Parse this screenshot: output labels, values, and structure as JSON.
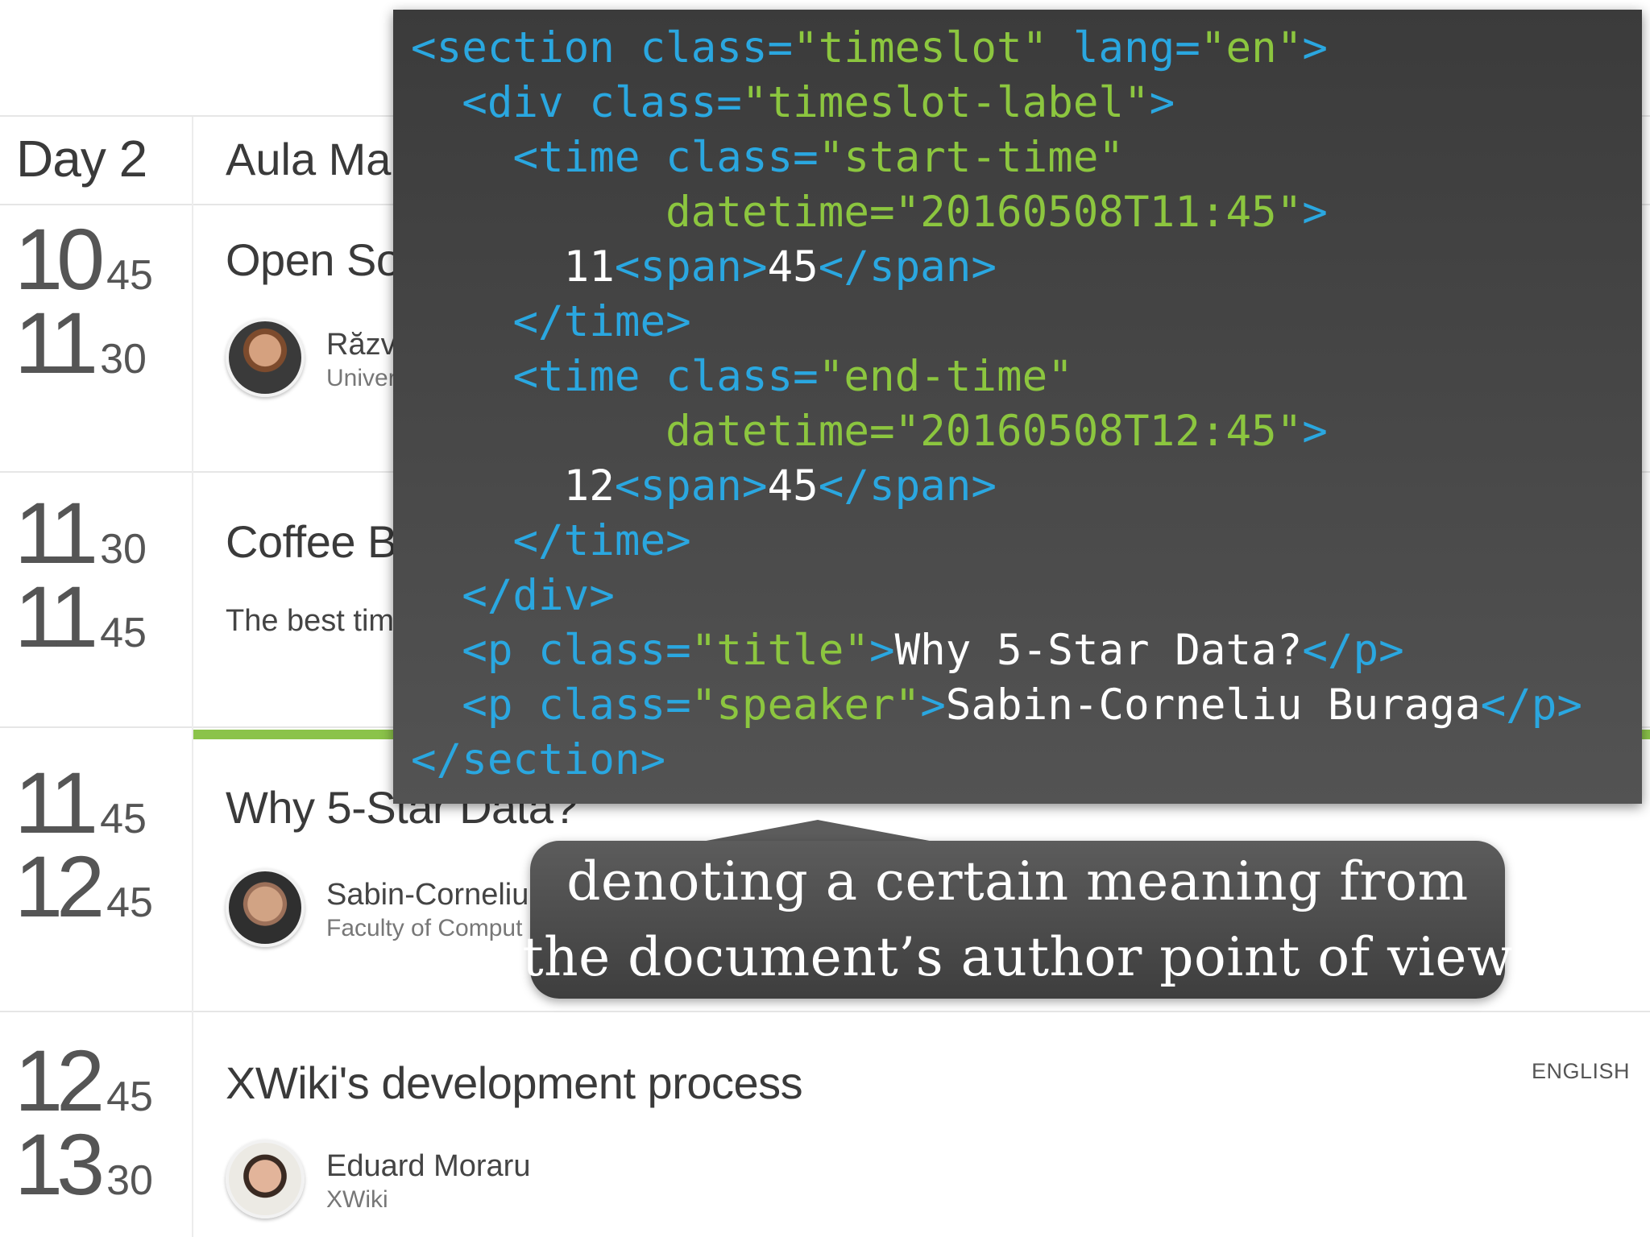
{
  "schedule": {
    "day": "Day 2",
    "room": "Aula Ma",
    "slots": [
      {
        "start": {
          "hour": "10",
          "min": "45"
        },
        "end": {
          "hour": "11",
          "min": "30"
        },
        "title": "Open So",
        "speaker": {
          "name": "Răzv",
          "affiliation": "Univer"
        }
      },
      {
        "start": {
          "hour": "11",
          "min": "30"
        },
        "end": {
          "hour": "11",
          "min": "45"
        },
        "title": "Coffee B",
        "description": "The best tim"
      },
      {
        "start": {
          "hour": "11",
          "min": "45"
        },
        "end": {
          "hour": "12",
          "min": "45"
        },
        "title": "Why 5-Star Data?",
        "speaker": {
          "name": "Sabin-Corneliu",
          "affiliation": "Faculty of Comput"
        }
      },
      {
        "start": {
          "hour": "12",
          "min": "45"
        },
        "end": {
          "hour": "13",
          "min": "30"
        },
        "title": "XWiki's development process",
        "language": "ENGLISH",
        "speaker": {
          "name": "Eduard Moraru",
          "affiliation": "XWiki"
        }
      }
    ]
  },
  "code_lines": [
    [
      {
        "t": "tag",
        "v": "<section "
      },
      {
        "t": "attr",
        "v": "class="
      },
      {
        "t": "str",
        "v": "\"timeslot\""
      },
      {
        "t": "attr",
        "v": " lang="
      },
      {
        "t": "str",
        "v": "\"en\""
      },
      {
        "t": "tag",
        "v": ">"
      }
    ],
    [
      {
        "t": "txt",
        "v": "  "
      },
      {
        "t": "tag",
        "v": "<div "
      },
      {
        "t": "attr",
        "v": "class="
      },
      {
        "t": "str",
        "v": "\"timeslot-label\""
      },
      {
        "t": "tag",
        "v": ">"
      }
    ],
    [
      {
        "t": "txt",
        "v": "    "
      },
      {
        "t": "tag",
        "v": "<time "
      },
      {
        "t": "attr",
        "v": "class="
      },
      {
        "t": "str",
        "v": "\"start-time\""
      }
    ],
    [
      {
        "t": "txt",
        "v": "          "
      },
      {
        "t": "str",
        "v": "datetime=\"20160508T11:45\""
      },
      {
        "t": "tag",
        "v": ">"
      }
    ],
    [
      {
        "t": "txt",
        "v": "      11"
      },
      {
        "t": "tag",
        "v": "<span>"
      },
      {
        "t": "txt",
        "v": "45"
      },
      {
        "t": "tag",
        "v": "</span>"
      }
    ],
    [
      {
        "t": "txt",
        "v": "    "
      },
      {
        "t": "tag",
        "v": "</time>"
      }
    ],
    [
      {
        "t": "txt",
        "v": "    "
      },
      {
        "t": "tag",
        "v": "<time "
      },
      {
        "t": "attr",
        "v": "class="
      },
      {
        "t": "str",
        "v": "\"end-time\""
      }
    ],
    [
      {
        "t": "txt",
        "v": "          "
      },
      {
        "t": "str",
        "v": "datetime=\"20160508T12:45\""
      },
      {
        "t": "tag",
        "v": ">"
      }
    ],
    [
      {
        "t": "txt",
        "v": "      12"
      },
      {
        "t": "tag",
        "v": "<span>"
      },
      {
        "t": "txt",
        "v": "45"
      },
      {
        "t": "tag",
        "v": "</span>"
      }
    ],
    [
      {
        "t": "txt",
        "v": "    "
      },
      {
        "t": "tag",
        "v": "</time>"
      }
    ],
    [
      {
        "t": "txt",
        "v": "  "
      },
      {
        "t": "tag",
        "v": "</div>"
      }
    ],
    [
      {
        "t": "txt",
        "v": "  "
      },
      {
        "t": "tag",
        "v": "<p "
      },
      {
        "t": "attr",
        "v": "class="
      },
      {
        "t": "str",
        "v": "\"title\""
      },
      {
        "t": "tag",
        "v": ">"
      },
      {
        "t": "txt",
        "v": "Why 5-Star Data?"
      },
      {
        "t": "tag",
        "v": "</p>"
      }
    ],
    [
      {
        "t": "txt",
        "v": "  "
      },
      {
        "t": "tag",
        "v": "<p "
      },
      {
        "t": "attr",
        "v": "class="
      },
      {
        "t": "str",
        "v": "\"speaker\""
      },
      {
        "t": "tag",
        "v": ">"
      },
      {
        "t": "txt",
        "v": "Sabin-Corneliu Buraga"
      },
      {
        "t": "tag",
        "v": "</p>"
      }
    ],
    [
      {
        "t": "tag",
        "v": "</section>"
      }
    ]
  ],
  "callout": {
    "line1": "denoting a certain meaning from",
    "line2": "the document’s author point of view"
  },
  "colors": {
    "code_tag": "#2aa7e0",
    "code_string": "#8cc63f",
    "code_text": "#ffffff",
    "active_bar": "#8bc34a"
  }
}
